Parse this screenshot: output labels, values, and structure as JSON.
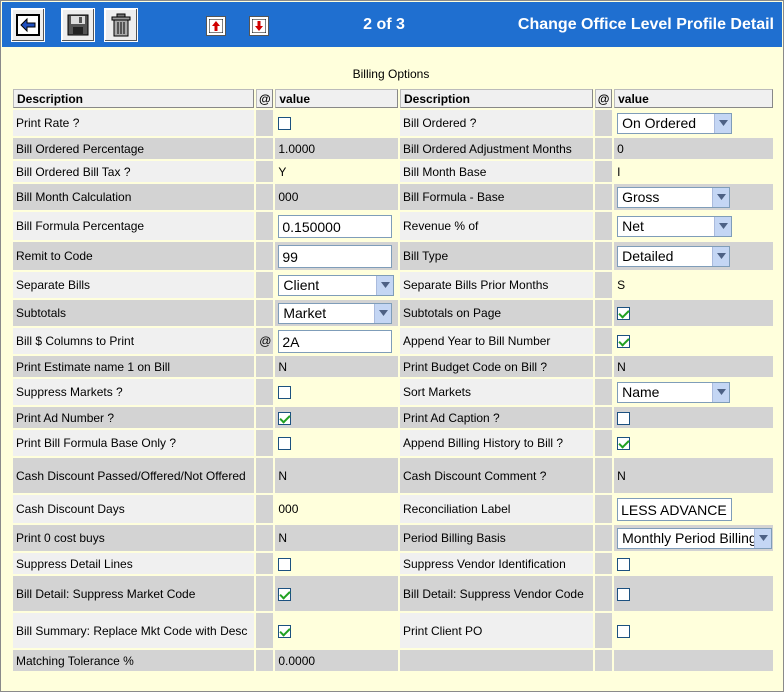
{
  "toolbar": {
    "pager": "2 of 3",
    "title": "Change Office Level Profile Detail"
  },
  "section_caption": "Billing Options",
  "headers": {
    "description": "Description",
    "at": "@",
    "value": "value"
  },
  "rows": [
    {
      "left": {
        "label": "Print Rate ?",
        "at": "",
        "type": "checkbox",
        "checked": false,
        "value": ""
      },
      "right": {
        "label": "Bill Ordered ?",
        "at": "",
        "type": "select",
        "value": "On Ordered"
      }
    },
    {
      "left": {
        "label": "Bill Ordered Percentage",
        "at": "",
        "type": "text",
        "value": "1.0000"
      },
      "right": {
        "label": "Bill Ordered Adjustment Months",
        "at": "",
        "type": "text",
        "value": "0"
      }
    },
    {
      "left": {
        "label": "Bill Ordered Bill Tax ?",
        "at": "",
        "type": "text",
        "value": "Y"
      },
      "right": {
        "label": "Bill Month Base",
        "at": "",
        "type": "text",
        "value": "I"
      }
    },
    {
      "left": {
        "label": "Bill Month Calculation",
        "at": "",
        "type": "text",
        "value": "000"
      },
      "right": {
        "label": "Bill Formula - Base",
        "at": "",
        "type": "select",
        "value": "Gross"
      }
    },
    {
      "left": {
        "label": "Bill Formula Percentage",
        "at": "",
        "type": "input",
        "value": "0.150000"
      },
      "right": {
        "label": "Revenue % of",
        "at": "",
        "type": "select",
        "value": "Net"
      }
    },
    {
      "left": {
        "label": "Remit to Code",
        "at": "",
        "type": "input",
        "value": "99"
      },
      "right": {
        "label": "Bill Type",
        "at": "",
        "type": "select",
        "value": "Detailed"
      }
    },
    {
      "left": {
        "label": "Separate Bills",
        "at": "",
        "type": "select",
        "value": "Client"
      },
      "right": {
        "label": "Separate Bills Prior Months",
        "at": "",
        "type": "text",
        "value": "S"
      }
    },
    {
      "left": {
        "label": "Subtotals",
        "at": "",
        "type": "select",
        "value": "Market"
      },
      "right": {
        "label": "Subtotals on Page",
        "at": "",
        "type": "checkbox",
        "checked": true,
        "value": ""
      }
    },
    {
      "left": {
        "label": "Bill $ Columns to Print",
        "at": "@",
        "type": "input",
        "value": "2A"
      },
      "right": {
        "label": "Append Year to Bill Number",
        "at": "",
        "type": "checkbox",
        "checked": true,
        "value": ""
      }
    },
    {
      "left": {
        "label": "Print Estimate name 1 on Bill",
        "at": "",
        "type": "text",
        "value": "N"
      },
      "right": {
        "label": "Print Budget Code on Bill ?",
        "at": "",
        "type": "text",
        "value": "N"
      }
    },
    {
      "left": {
        "label": "Suppress Markets ?",
        "at": "",
        "type": "checkbox",
        "checked": false,
        "value": ""
      },
      "right": {
        "label": "Sort Markets",
        "at": "",
        "type": "select",
        "value": "Name"
      }
    },
    {
      "left": {
        "label": "Print Ad Number ?",
        "at": "",
        "type": "checkbox",
        "checked": true,
        "value": ""
      },
      "right": {
        "label": "Print Ad Caption ?",
        "at": "",
        "type": "checkbox",
        "checked": false,
        "value": ""
      }
    },
    {
      "left": {
        "label": "Print Bill Formula Base Only ?",
        "at": "",
        "type": "checkbox",
        "checked": false,
        "value": ""
      },
      "right": {
        "label": "Append Billing History to Bill ?",
        "at": "",
        "type": "checkbox",
        "checked": true,
        "value": ""
      }
    },
    {
      "left": {
        "label": "Cash Discount Passed/Offered/Not Offered",
        "at": "",
        "type": "text",
        "value": "N"
      },
      "right": {
        "label": "Cash Discount Comment ?",
        "at": "",
        "type": "text",
        "value": "N"
      }
    },
    {
      "left": {
        "label": "Cash Discount Days",
        "at": "",
        "type": "text",
        "value": "000"
      },
      "right": {
        "label": "Reconciliation Label",
        "at": "",
        "type": "input",
        "value": "LESS ADVANCE BILLING"
      }
    },
    {
      "left": {
        "label": "Print 0 cost buys",
        "at": "",
        "type": "text",
        "value": "N"
      },
      "right": {
        "label": "Period Billing Basis",
        "at": "",
        "type": "select",
        "value": "Monthly Period Billing"
      }
    },
    {
      "left": {
        "label": "Suppress Detail Lines",
        "at": "",
        "type": "checkbox",
        "checked": false,
        "value": ""
      },
      "right": {
        "label": "Suppress Vendor Identification",
        "at": "",
        "type": "checkbox",
        "checked": false,
        "value": ""
      }
    },
    {
      "left": {
        "label": "Bill Detail: Suppress Market Code",
        "at": "",
        "type": "checkbox",
        "checked": true,
        "value": ""
      },
      "right": {
        "label": "Bill Detail: Suppress Vendor Code",
        "at": "",
        "type": "checkbox",
        "checked": false,
        "value": ""
      }
    },
    {
      "left": {
        "label": "Bill Summary: Replace Mkt Code with Desc",
        "at": "",
        "type": "checkbox",
        "checked": true,
        "value": ""
      },
      "right": {
        "label": "Print Client PO",
        "at": "",
        "type": "checkbox",
        "checked": false,
        "value": ""
      }
    },
    {
      "left": {
        "label": "Matching Tolerance %",
        "at": "",
        "type": "text",
        "value": "0.0000"
      },
      "right": {
        "label": "",
        "at": "",
        "type": "text",
        "value": ""
      }
    }
  ]
}
